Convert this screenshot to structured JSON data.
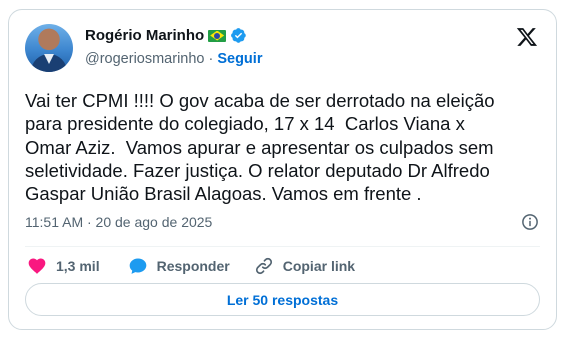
{
  "author": {
    "name": "Rogério Marinho",
    "handle": "@rogeriosmarinho",
    "separator": "·",
    "follow_label": "Seguir",
    "flag_icon": "brazil-flag-icon",
    "verified_icon": "verified-badge-icon"
  },
  "brand_icon": "x-logo-icon",
  "tweet": {
    "text": "Vai ter CPMI !!!! O gov acaba de ser derrotado na eleição\npara presidente do colegiado, 17 x 14  Carlos Viana x\nOmar Aziz.  Vamos apurar e apresentar os culpados sem\nseletividade. Fazer justiça. O relator deputado Dr Alfredo\nGaspar União Brasil Alagoas. Vamos em frente .",
    "timestamp": "11:51 AM · 20 de ago de 2025"
  },
  "actions": {
    "like_count": "1,3 mil",
    "reply_label": "Responder",
    "copy_link_label": "Copiar link"
  },
  "replies_button_label": "Ler 50 respostas",
  "colors": {
    "accent": "#006fd6",
    "like": "#f91880",
    "verified": "#1d9bf0",
    "secondary_text": "#536471",
    "border": "#cfd9de"
  }
}
